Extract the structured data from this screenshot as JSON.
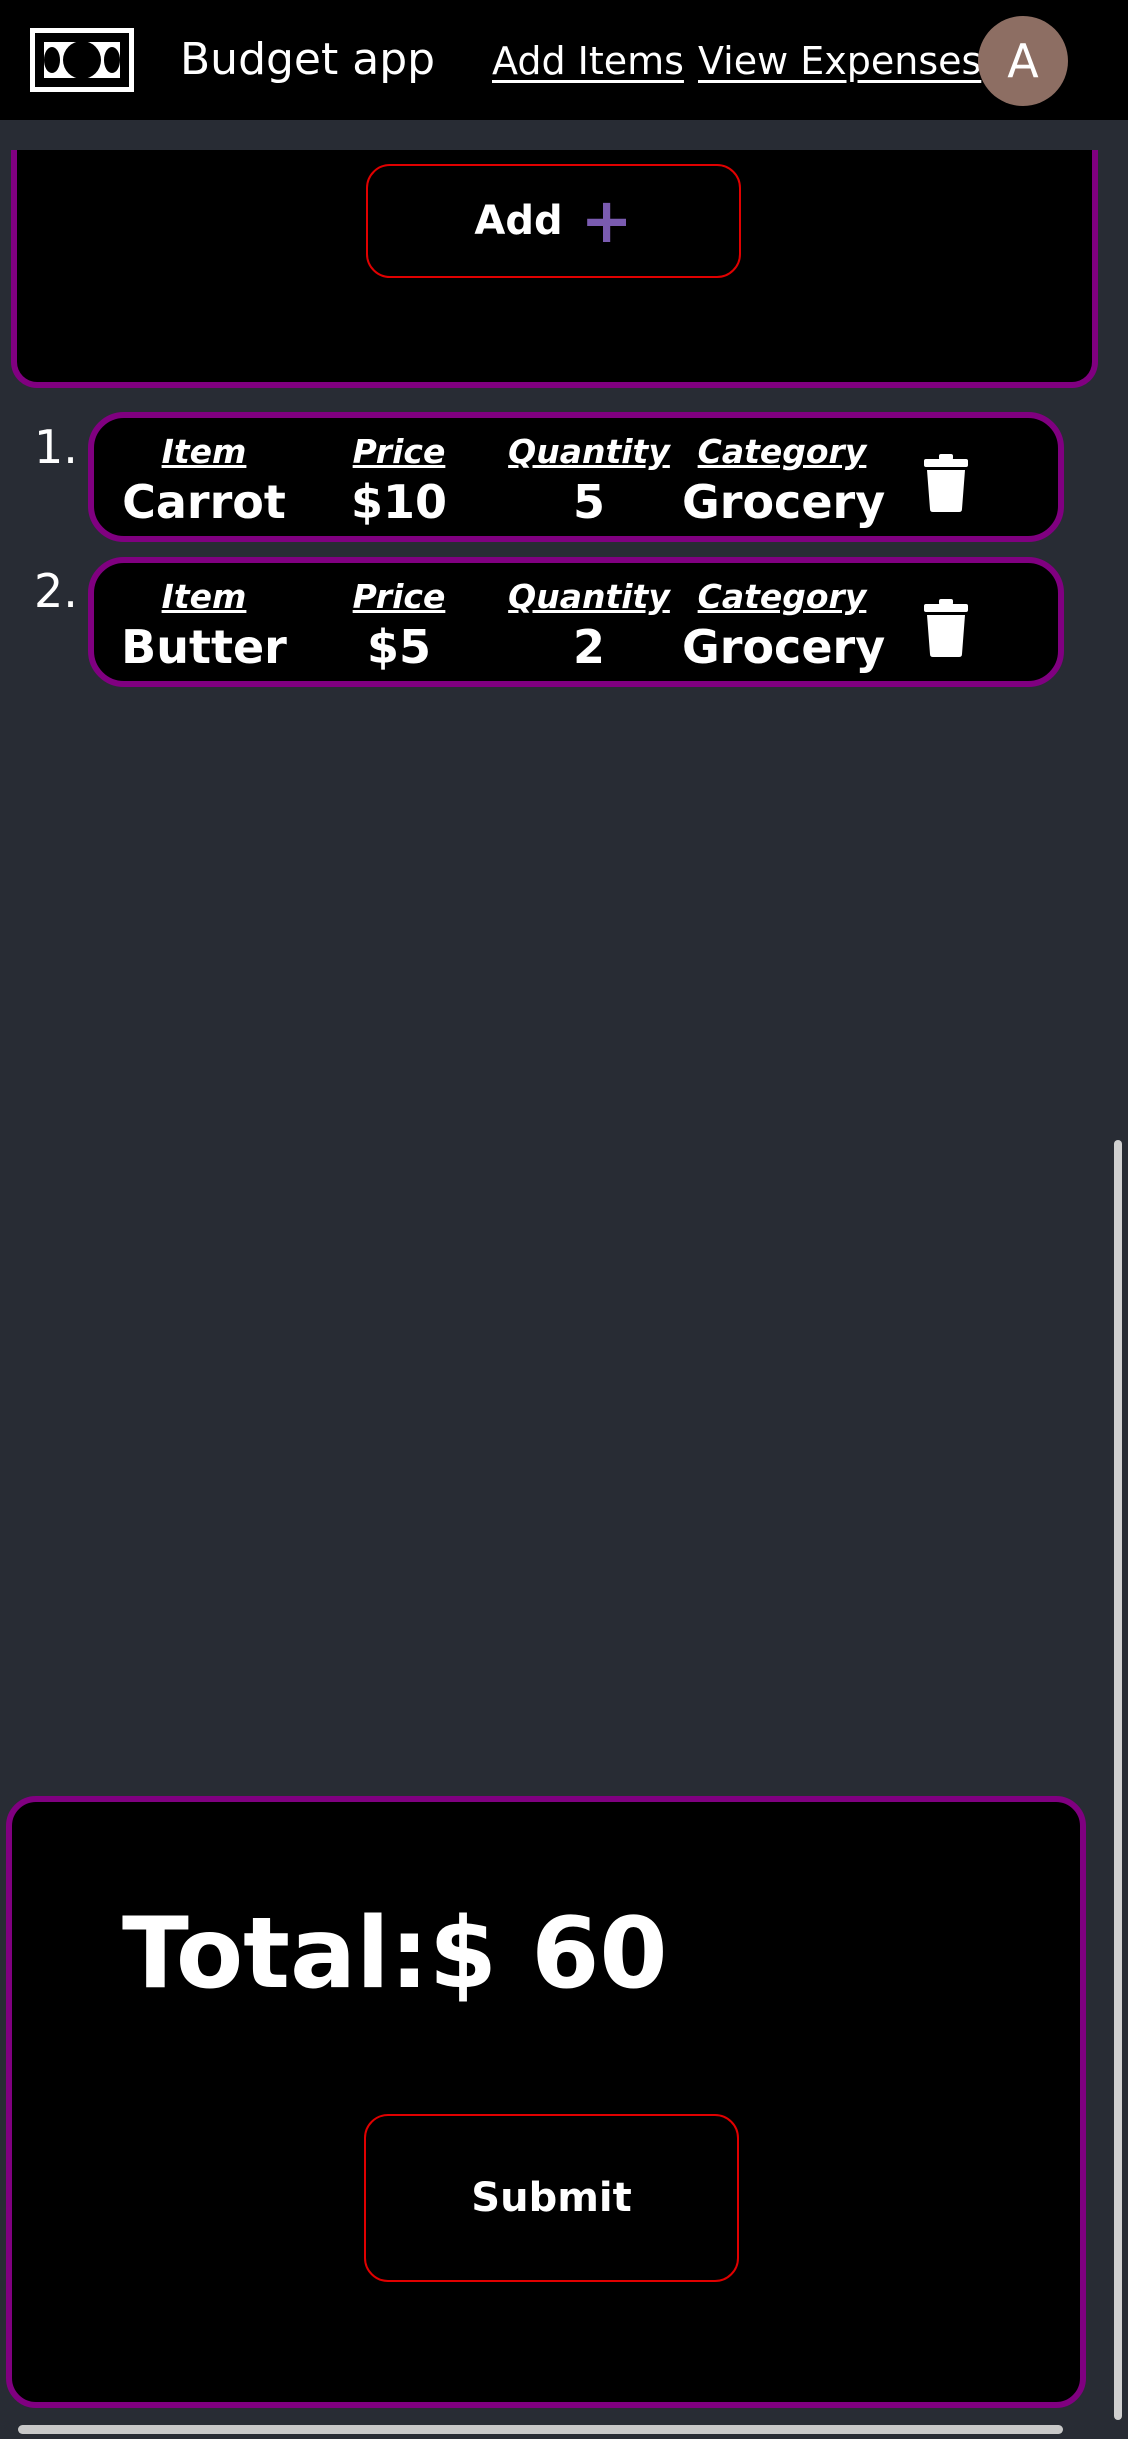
{
  "navbar": {
    "brand": "Budget app",
    "links": [
      {
        "label": "Add Items"
      },
      {
        "label": "View Expenses"
      }
    ],
    "avatar_initial": "A",
    "logo_icon": "money-bill-icon"
  },
  "add_panel": {
    "add_label": "Add",
    "add_icon": "plus-icon"
  },
  "items": [
    {
      "index": "1.",
      "item_label": "Item",
      "item": "Carrot",
      "price_label": "Price",
      "price": "$10",
      "quantity_label": "Quantity",
      "quantity": "5",
      "category_label": "Category",
      "category": "Grocery",
      "delete_icon": "trash-icon"
    },
    {
      "index": "2.",
      "item_label": "Item",
      "item": "Butter",
      "price_label": "Price",
      "price": "$5",
      "quantity_label": "Quantity",
      "quantity": "2",
      "category_label": "Category",
      "category": "Grocery",
      "delete_icon": "trash-icon"
    }
  ],
  "summary": {
    "total_text": "Total:$ 60",
    "submit_label": "Submit"
  },
  "colors": {
    "background": "#282c34",
    "panel": "#000000",
    "accent_border": "#800080",
    "button_border": "#e00000",
    "plus": "#7a5bb0",
    "avatar": "#8d6e63"
  }
}
